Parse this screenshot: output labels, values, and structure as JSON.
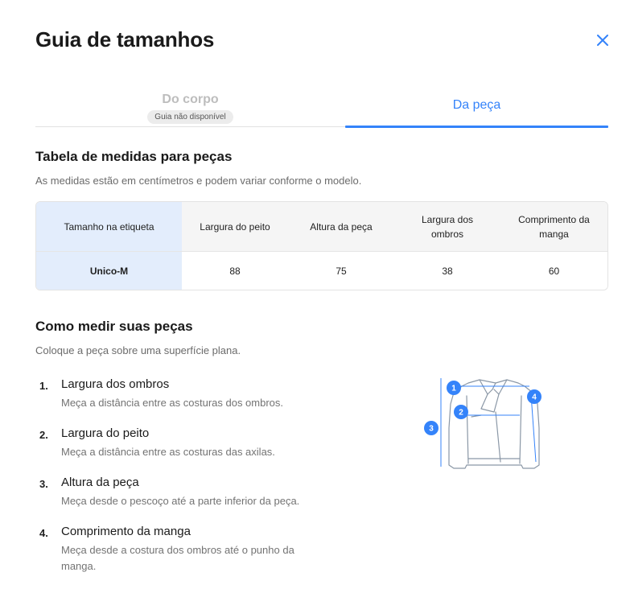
{
  "header": {
    "title": "Guia de tamanhos"
  },
  "tabs": [
    {
      "label": "Do corpo",
      "badge": "Guia não disponível",
      "active": false
    },
    {
      "label": "Da peça",
      "active": true
    }
  ],
  "measures_table": {
    "title": "Tabela de medidas para peças",
    "description": "As medidas estão em centímetros e podem variar conforme o modelo.",
    "columns": [
      "Tamanho na etiqueta",
      "Largura do peito",
      "Altura da peça",
      "Largura dos ombros",
      "Comprimento da manga"
    ],
    "rows": [
      [
        "Unico-M",
        "88",
        "75",
        "38",
        "60"
      ]
    ]
  },
  "how_to_measure": {
    "title": "Como medir suas peças",
    "description": "Coloque a peça sobre uma superfície plana.",
    "steps": [
      {
        "number": "1.",
        "title": "Largura dos ombros",
        "description": "Meça a distância entre as costuras dos ombros."
      },
      {
        "number": "2.",
        "title": "Largura do peito",
        "description": "Meça a distância entre as costuras das axilas."
      },
      {
        "number": "3.",
        "title": "Altura da peça",
        "description": "Meça desde o pescoço até a parte inferior da peça."
      },
      {
        "number": "4.",
        "title": "Comprimento da manga",
        "description": "Meça desde a costura dos ombros até o punho da manga."
      }
    ],
    "illustration": {
      "icon": "jacket-measurement-icon",
      "markers": [
        "1",
        "2",
        "3",
        "4"
      ]
    }
  },
  "colors": {
    "accent": "#3483fa",
    "highlight_column": "#e3edfc"
  }
}
